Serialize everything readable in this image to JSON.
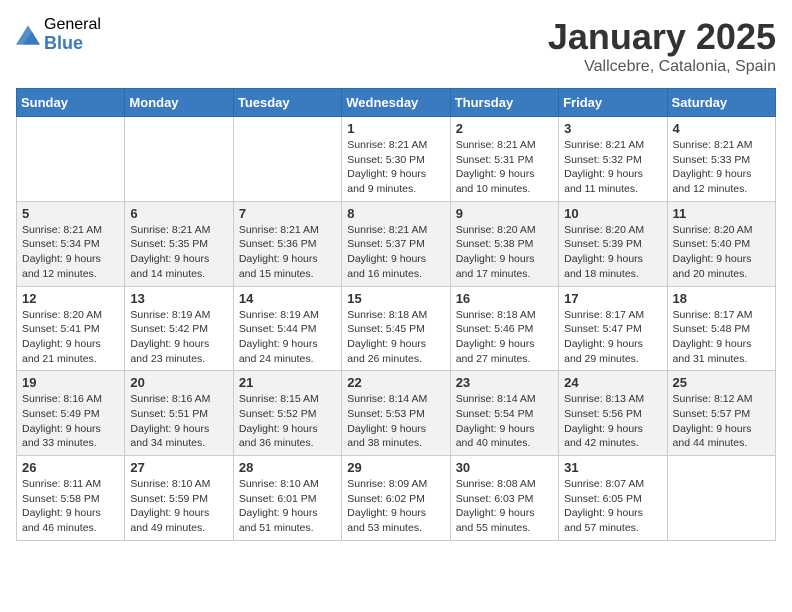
{
  "logo": {
    "general": "General",
    "blue": "Blue"
  },
  "header": {
    "month": "January 2025",
    "location": "Vallcebre, Catalonia, Spain"
  },
  "weekdays": [
    "Sunday",
    "Monday",
    "Tuesday",
    "Wednesday",
    "Thursday",
    "Friday",
    "Saturday"
  ],
  "weeks": [
    [
      {
        "day": "",
        "sunrise": "",
        "sunset": "",
        "daylight": ""
      },
      {
        "day": "",
        "sunrise": "",
        "sunset": "",
        "daylight": ""
      },
      {
        "day": "",
        "sunrise": "",
        "sunset": "",
        "daylight": ""
      },
      {
        "day": "1",
        "sunrise": "Sunrise: 8:21 AM",
        "sunset": "Sunset: 5:30 PM",
        "daylight": "Daylight: 9 hours and 9 minutes."
      },
      {
        "day": "2",
        "sunrise": "Sunrise: 8:21 AM",
        "sunset": "Sunset: 5:31 PM",
        "daylight": "Daylight: 9 hours and 10 minutes."
      },
      {
        "day": "3",
        "sunrise": "Sunrise: 8:21 AM",
        "sunset": "Sunset: 5:32 PM",
        "daylight": "Daylight: 9 hours and 11 minutes."
      },
      {
        "day": "4",
        "sunrise": "Sunrise: 8:21 AM",
        "sunset": "Sunset: 5:33 PM",
        "daylight": "Daylight: 9 hours and 12 minutes."
      }
    ],
    [
      {
        "day": "5",
        "sunrise": "Sunrise: 8:21 AM",
        "sunset": "Sunset: 5:34 PM",
        "daylight": "Daylight: 9 hours and 12 minutes."
      },
      {
        "day": "6",
        "sunrise": "Sunrise: 8:21 AM",
        "sunset": "Sunset: 5:35 PM",
        "daylight": "Daylight: 9 hours and 14 minutes."
      },
      {
        "day": "7",
        "sunrise": "Sunrise: 8:21 AM",
        "sunset": "Sunset: 5:36 PM",
        "daylight": "Daylight: 9 hours and 15 minutes."
      },
      {
        "day": "8",
        "sunrise": "Sunrise: 8:21 AM",
        "sunset": "Sunset: 5:37 PM",
        "daylight": "Daylight: 9 hours and 16 minutes."
      },
      {
        "day": "9",
        "sunrise": "Sunrise: 8:20 AM",
        "sunset": "Sunset: 5:38 PM",
        "daylight": "Daylight: 9 hours and 17 minutes."
      },
      {
        "day": "10",
        "sunrise": "Sunrise: 8:20 AM",
        "sunset": "Sunset: 5:39 PM",
        "daylight": "Daylight: 9 hours and 18 minutes."
      },
      {
        "day": "11",
        "sunrise": "Sunrise: 8:20 AM",
        "sunset": "Sunset: 5:40 PM",
        "daylight": "Daylight: 9 hours and 20 minutes."
      }
    ],
    [
      {
        "day": "12",
        "sunrise": "Sunrise: 8:20 AM",
        "sunset": "Sunset: 5:41 PM",
        "daylight": "Daylight: 9 hours and 21 minutes."
      },
      {
        "day": "13",
        "sunrise": "Sunrise: 8:19 AM",
        "sunset": "Sunset: 5:42 PM",
        "daylight": "Daylight: 9 hours and 23 minutes."
      },
      {
        "day": "14",
        "sunrise": "Sunrise: 8:19 AM",
        "sunset": "Sunset: 5:44 PM",
        "daylight": "Daylight: 9 hours and 24 minutes."
      },
      {
        "day": "15",
        "sunrise": "Sunrise: 8:18 AM",
        "sunset": "Sunset: 5:45 PM",
        "daylight": "Daylight: 9 hours and 26 minutes."
      },
      {
        "day": "16",
        "sunrise": "Sunrise: 8:18 AM",
        "sunset": "Sunset: 5:46 PM",
        "daylight": "Daylight: 9 hours and 27 minutes."
      },
      {
        "day": "17",
        "sunrise": "Sunrise: 8:17 AM",
        "sunset": "Sunset: 5:47 PM",
        "daylight": "Daylight: 9 hours and 29 minutes."
      },
      {
        "day": "18",
        "sunrise": "Sunrise: 8:17 AM",
        "sunset": "Sunset: 5:48 PM",
        "daylight": "Daylight: 9 hours and 31 minutes."
      }
    ],
    [
      {
        "day": "19",
        "sunrise": "Sunrise: 8:16 AM",
        "sunset": "Sunset: 5:49 PM",
        "daylight": "Daylight: 9 hours and 33 minutes."
      },
      {
        "day": "20",
        "sunrise": "Sunrise: 8:16 AM",
        "sunset": "Sunset: 5:51 PM",
        "daylight": "Daylight: 9 hours and 34 minutes."
      },
      {
        "day": "21",
        "sunrise": "Sunrise: 8:15 AM",
        "sunset": "Sunset: 5:52 PM",
        "daylight": "Daylight: 9 hours and 36 minutes."
      },
      {
        "day": "22",
        "sunrise": "Sunrise: 8:14 AM",
        "sunset": "Sunset: 5:53 PM",
        "daylight": "Daylight: 9 hours and 38 minutes."
      },
      {
        "day": "23",
        "sunrise": "Sunrise: 8:14 AM",
        "sunset": "Sunset: 5:54 PM",
        "daylight": "Daylight: 9 hours and 40 minutes."
      },
      {
        "day": "24",
        "sunrise": "Sunrise: 8:13 AM",
        "sunset": "Sunset: 5:56 PM",
        "daylight": "Daylight: 9 hours and 42 minutes."
      },
      {
        "day": "25",
        "sunrise": "Sunrise: 8:12 AM",
        "sunset": "Sunset: 5:57 PM",
        "daylight": "Daylight: 9 hours and 44 minutes."
      }
    ],
    [
      {
        "day": "26",
        "sunrise": "Sunrise: 8:11 AM",
        "sunset": "Sunset: 5:58 PM",
        "daylight": "Daylight: 9 hours and 46 minutes."
      },
      {
        "day": "27",
        "sunrise": "Sunrise: 8:10 AM",
        "sunset": "Sunset: 5:59 PM",
        "daylight": "Daylight: 9 hours and 49 minutes."
      },
      {
        "day": "28",
        "sunrise": "Sunrise: 8:10 AM",
        "sunset": "Sunset: 6:01 PM",
        "daylight": "Daylight: 9 hours and 51 minutes."
      },
      {
        "day": "29",
        "sunrise": "Sunrise: 8:09 AM",
        "sunset": "Sunset: 6:02 PM",
        "daylight": "Daylight: 9 hours and 53 minutes."
      },
      {
        "day": "30",
        "sunrise": "Sunrise: 8:08 AM",
        "sunset": "Sunset: 6:03 PM",
        "daylight": "Daylight: 9 hours and 55 minutes."
      },
      {
        "day": "31",
        "sunrise": "Sunrise: 8:07 AM",
        "sunset": "Sunset: 6:05 PM",
        "daylight": "Daylight: 9 hours and 57 minutes."
      },
      {
        "day": "",
        "sunrise": "",
        "sunset": "",
        "daylight": ""
      }
    ]
  ]
}
